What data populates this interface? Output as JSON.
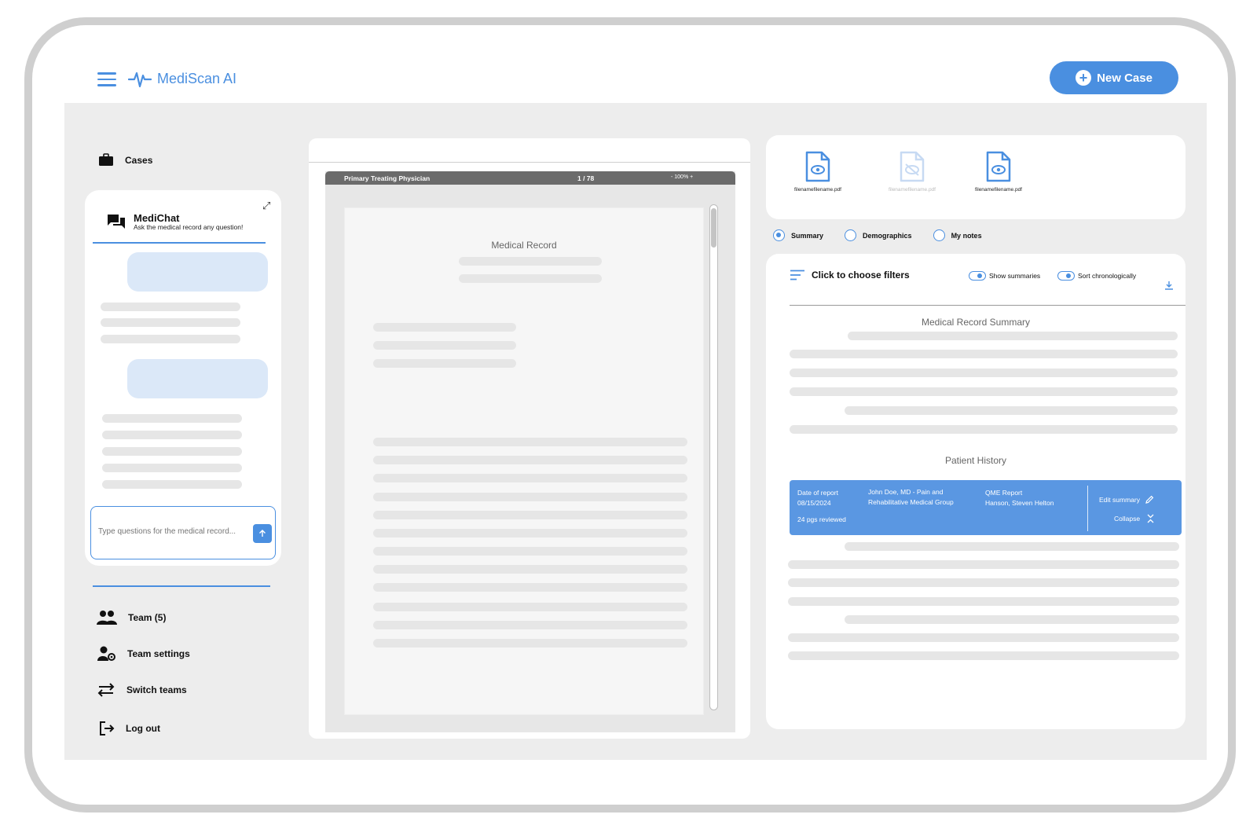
{
  "app": {
    "title": "MediScan AI",
    "new_case_label": "New Case",
    "accent_color": "#4a8fe0"
  },
  "sidebar": {
    "cases_label": "Cases",
    "bottom_items": [
      {
        "label": "Team (5)",
        "icon": "team-icon"
      },
      {
        "label": "Team settings",
        "icon": "team-settings-icon"
      },
      {
        "label": "Switch teams",
        "icon": "switch-icon"
      },
      {
        "label": "Log out",
        "icon": "logout-icon"
      }
    ]
  },
  "chat": {
    "title": "MediChat",
    "subtitle": "Ask the medical record any question!",
    "input_placeholder": "Type questions for the medical record..."
  },
  "viewer": {
    "document_label": "Primary Treating Physician",
    "page_indicator": "1 / 78",
    "zoom_label": "-  100%  +",
    "page_title": "Medical Record"
  },
  "files": [
    {
      "name": "filenamefilename.pdf",
      "state": "visible"
    },
    {
      "name": "filenamefilename.pdf",
      "state": "hidden"
    },
    {
      "name": "filenamefilename.pdf",
      "state": "visible"
    }
  ],
  "tabs": [
    {
      "label": "Summary",
      "selected": true
    },
    {
      "label": "Demographics",
      "selected": false
    },
    {
      "label": "My notes",
      "selected": false
    }
  ],
  "summary_panel": {
    "filter_label": "Click to choose filters",
    "show_summaries_label": "Show summaries",
    "sort_label": "Sort chronologically",
    "summary_title": "Medical Record Summary",
    "history_title": "Patient History",
    "history_entry": {
      "date_label": "Date of report",
      "date": "08/15/2024",
      "pages_reviewed": "24 pgs reviewed",
      "provider_line1": "John Doe, MD - Pain and",
      "provider_line2": "Rehabilitative Medical Group",
      "report_type": "QME Report",
      "patient": "Hanson, Steven Helton",
      "edit_label": "Edit summary",
      "collapse_label": "Collapse"
    }
  }
}
